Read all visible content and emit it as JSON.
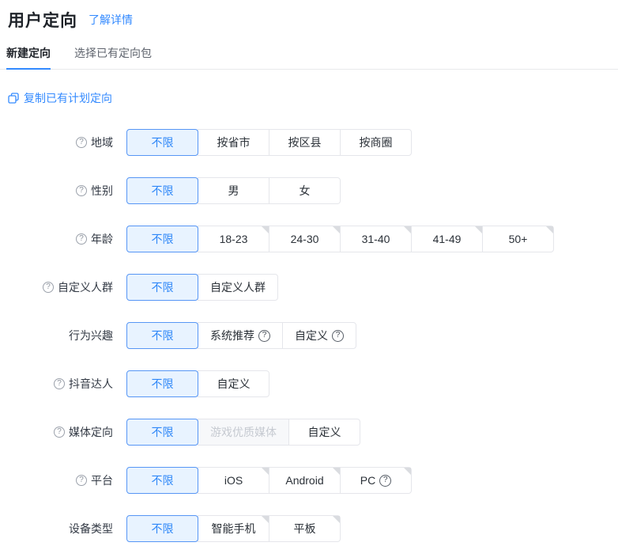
{
  "page": {
    "title": "用户定向",
    "learn_more_label": "了解详情"
  },
  "tabs": [
    {
      "label": "新建定向",
      "active": true
    },
    {
      "label": "选择已有定向包",
      "active": false
    }
  ],
  "copy_link": {
    "label": "复制已有计划定向"
  },
  "icons": {
    "help_glyph": "?"
  },
  "colors": {
    "accent_blue": "#338aff",
    "selected_bg": "#e8f3ff",
    "selected_border": "#5796f5",
    "button_border": "#e5e6eb",
    "disabled_bg": "#f7f8fa",
    "disabled_text": "#c6cad1",
    "notch_gray": "#dadce0"
  },
  "rows": [
    {
      "label": "地域",
      "help": true,
      "options": [
        {
          "label": "不限",
          "selected": true
        },
        {
          "label": "按省市"
        },
        {
          "label": "按区县"
        },
        {
          "label": "按商圈"
        }
      ]
    },
    {
      "label": "性别",
      "help": true,
      "options": [
        {
          "label": "不限",
          "selected": true
        },
        {
          "label": "男"
        },
        {
          "label": "女"
        }
      ]
    },
    {
      "label": "年龄",
      "help": true,
      "options": [
        {
          "label": "不限",
          "selected": true
        },
        {
          "label": "18-23",
          "notch": true
        },
        {
          "label": "24-30",
          "notch": true
        },
        {
          "label": "31-40",
          "notch": true
        },
        {
          "label": "41-49",
          "notch": true
        },
        {
          "label": "50+",
          "notch": true
        }
      ]
    },
    {
      "label": "自定义人群",
      "help": true,
      "options": [
        {
          "label": "不限",
          "selected": true
        },
        {
          "label": "自定义人群"
        }
      ]
    },
    {
      "label": "行为兴趣",
      "help": false,
      "options": [
        {
          "label": "不限",
          "selected": true
        },
        {
          "label": "系统推荐",
          "help": true
        },
        {
          "label": "自定义",
          "help": true
        }
      ]
    },
    {
      "label": "抖音达人",
      "help": true,
      "options": [
        {
          "label": "不限",
          "selected": true
        },
        {
          "label": "自定义"
        }
      ]
    },
    {
      "label": "媒体定向",
      "help": true,
      "options": [
        {
          "label": "不限",
          "selected": true
        },
        {
          "label": "游戏优质媒体",
          "disabled": true
        },
        {
          "label": "自定义"
        }
      ]
    },
    {
      "label": "平台",
      "help": true,
      "options": [
        {
          "label": "不限",
          "selected": true
        },
        {
          "label": "iOS",
          "notch": true
        },
        {
          "label": "Android",
          "notch": true
        },
        {
          "label": "PC",
          "help": true,
          "notch": true
        }
      ]
    },
    {
      "label": "设备类型",
      "help": false,
      "options": [
        {
          "label": "不限",
          "selected": true
        },
        {
          "label": "智能手机",
          "notch": true
        },
        {
          "label": "平板",
          "notch": true
        }
      ]
    }
  ]
}
